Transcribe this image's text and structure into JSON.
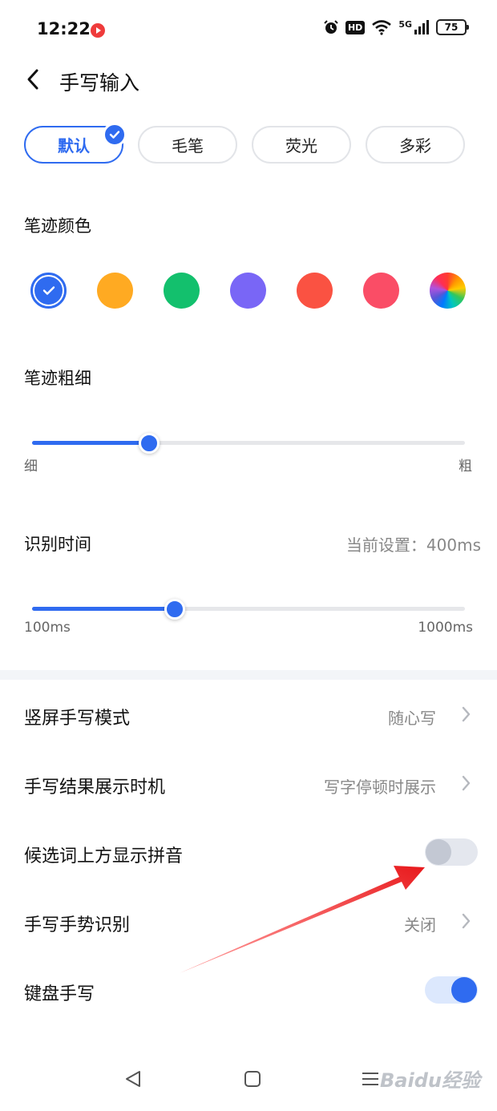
{
  "status_bar": {
    "time": "12:22",
    "hd_label": "HD",
    "network_label": "5G",
    "battery": "75"
  },
  "header": {
    "title": "手写输入"
  },
  "styles": [
    {
      "label": "默认",
      "selected": true
    },
    {
      "label": "毛笔",
      "selected": false
    },
    {
      "label": "荧光",
      "selected": false
    },
    {
      "label": "多彩",
      "selected": false
    }
  ],
  "stroke_color": {
    "label": "笔迹颜色",
    "colors": [
      "#2f6bf0",
      "#ffaa22",
      "#13c06d",
      "#7966f6",
      "#fa5242",
      "#fa4d66",
      "rainbow"
    ],
    "selected_index": 0
  },
  "stroke_width": {
    "label": "笔迹粗细",
    "min_label": "细",
    "max_label": "粗",
    "value_fraction": 0.27
  },
  "recognition_time": {
    "label": "识别时间",
    "current": "当前设置：400ms",
    "min_label": "100ms",
    "max_label": "1000ms",
    "value_fraction": 0.33
  },
  "settings": [
    {
      "label": "竖屏手写模式",
      "value": "随心写",
      "type": "nav"
    },
    {
      "label": "手写结果展示时机",
      "value": "写字停顿时展示",
      "type": "nav"
    },
    {
      "label": "候选词上方显示拼音",
      "type": "toggle",
      "on": false
    },
    {
      "label": "手写手势识别",
      "value": "关闭",
      "type": "nav"
    },
    {
      "label": "键盘手写",
      "type": "toggle",
      "on": true
    }
  ],
  "watermark": "Baidu经验",
  "colors": {
    "accent": "#2f6bf0",
    "arrow": "#e8191c"
  }
}
